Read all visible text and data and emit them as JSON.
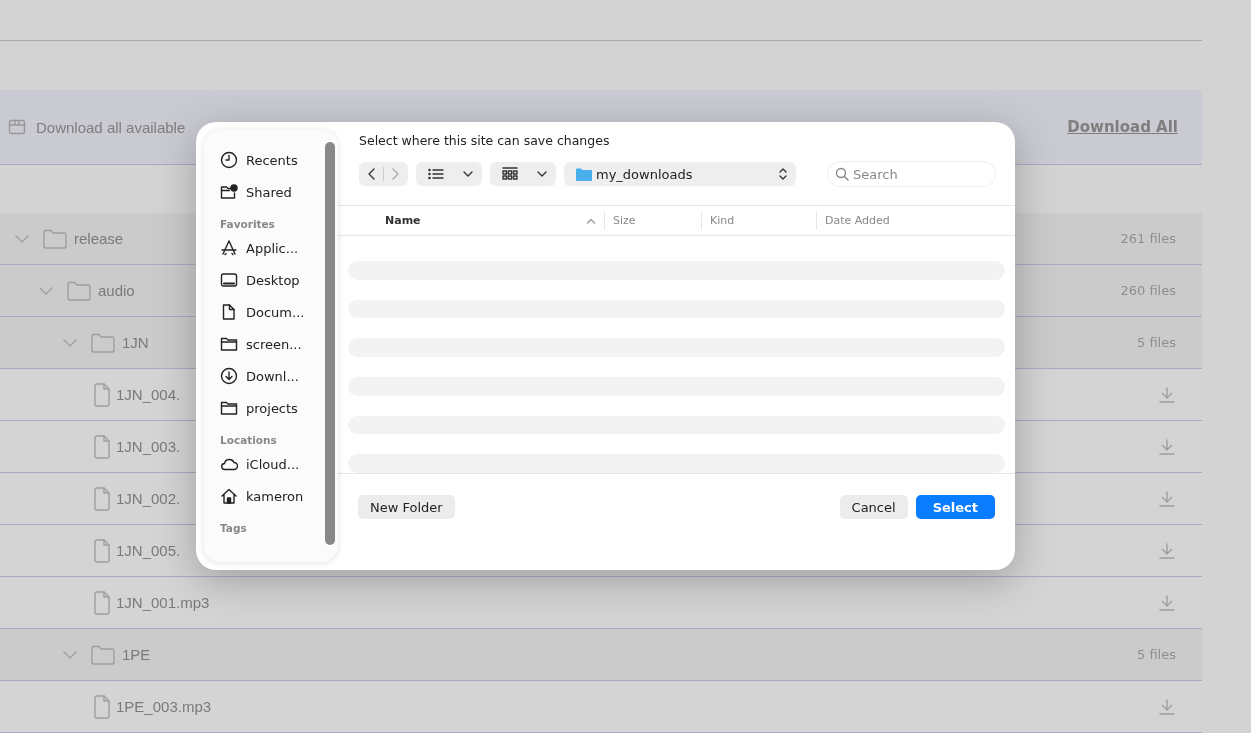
{
  "page": {
    "banner": {
      "text": "Download all available",
      "action": "Download All"
    },
    "tree": [
      {
        "kind": "folder",
        "name": "release",
        "count": "261 files",
        "expanded": true,
        "children": [
          {
            "kind": "folder",
            "name": "audio",
            "count": "260 files",
            "expanded": true,
            "children": [
              {
                "kind": "folder",
                "name": "1JN",
                "count": "5 files",
                "expanded": true,
                "children": [
                  {
                    "kind": "file",
                    "name": "1JN_004."
                  },
                  {
                    "kind": "file",
                    "name": "1JN_003."
                  },
                  {
                    "kind": "file",
                    "name": "1JN_002."
                  },
                  {
                    "kind": "file",
                    "name": "1JN_005."
                  },
                  {
                    "kind": "file",
                    "name": "1JN_001.mp3"
                  }
                ]
              },
              {
                "kind": "folder",
                "name": "1PE",
                "count": "5 files",
                "expanded": true,
                "children": [
                  {
                    "kind": "file",
                    "name": "1PE_003.mp3"
                  }
                ]
              }
            ]
          }
        ]
      }
    ]
  },
  "dialog": {
    "title": "Select where this site can save changes",
    "sidebar": [
      {
        "items": [
          {
            "kind": "recents",
            "label": "Recents"
          },
          {
            "kind": "shared",
            "label": "Shared"
          }
        ]
      },
      {
        "heading": "Favorites",
        "items": [
          {
            "kind": "applications",
            "label": "Applic..."
          },
          {
            "kind": "desktop",
            "label": "Desktop"
          },
          {
            "kind": "documents",
            "label": "Docum..."
          },
          {
            "kind": "folder",
            "label": "screen..."
          },
          {
            "kind": "downloads",
            "label": "Downl..."
          },
          {
            "kind": "folder",
            "label": "projects"
          }
        ]
      },
      {
        "heading": "Locations",
        "items": [
          {
            "kind": "icloud",
            "label": "iCloud..."
          },
          {
            "kind": "home",
            "label": "kameron"
          }
        ]
      },
      {
        "heading": "Tags"
      }
    ],
    "location": "my_downloads",
    "search": {
      "placeholder": "Search"
    },
    "columns": [
      {
        "label": "Name",
        "sorted": true
      },
      {
        "label": "Size",
        "sorted": false
      },
      {
        "label": "Kind",
        "sorted": false
      },
      {
        "label": "Date Added",
        "sorted": false
      }
    ],
    "loading": true,
    "buttons": [
      {
        "label": "New Folder",
        "kind": "secondary"
      },
      {
        "label": "Cancel",
        "kind": "secondary"
      },
      {
        "label": "Select",
        "kind": "primary"
      }
    ]
  }
}
